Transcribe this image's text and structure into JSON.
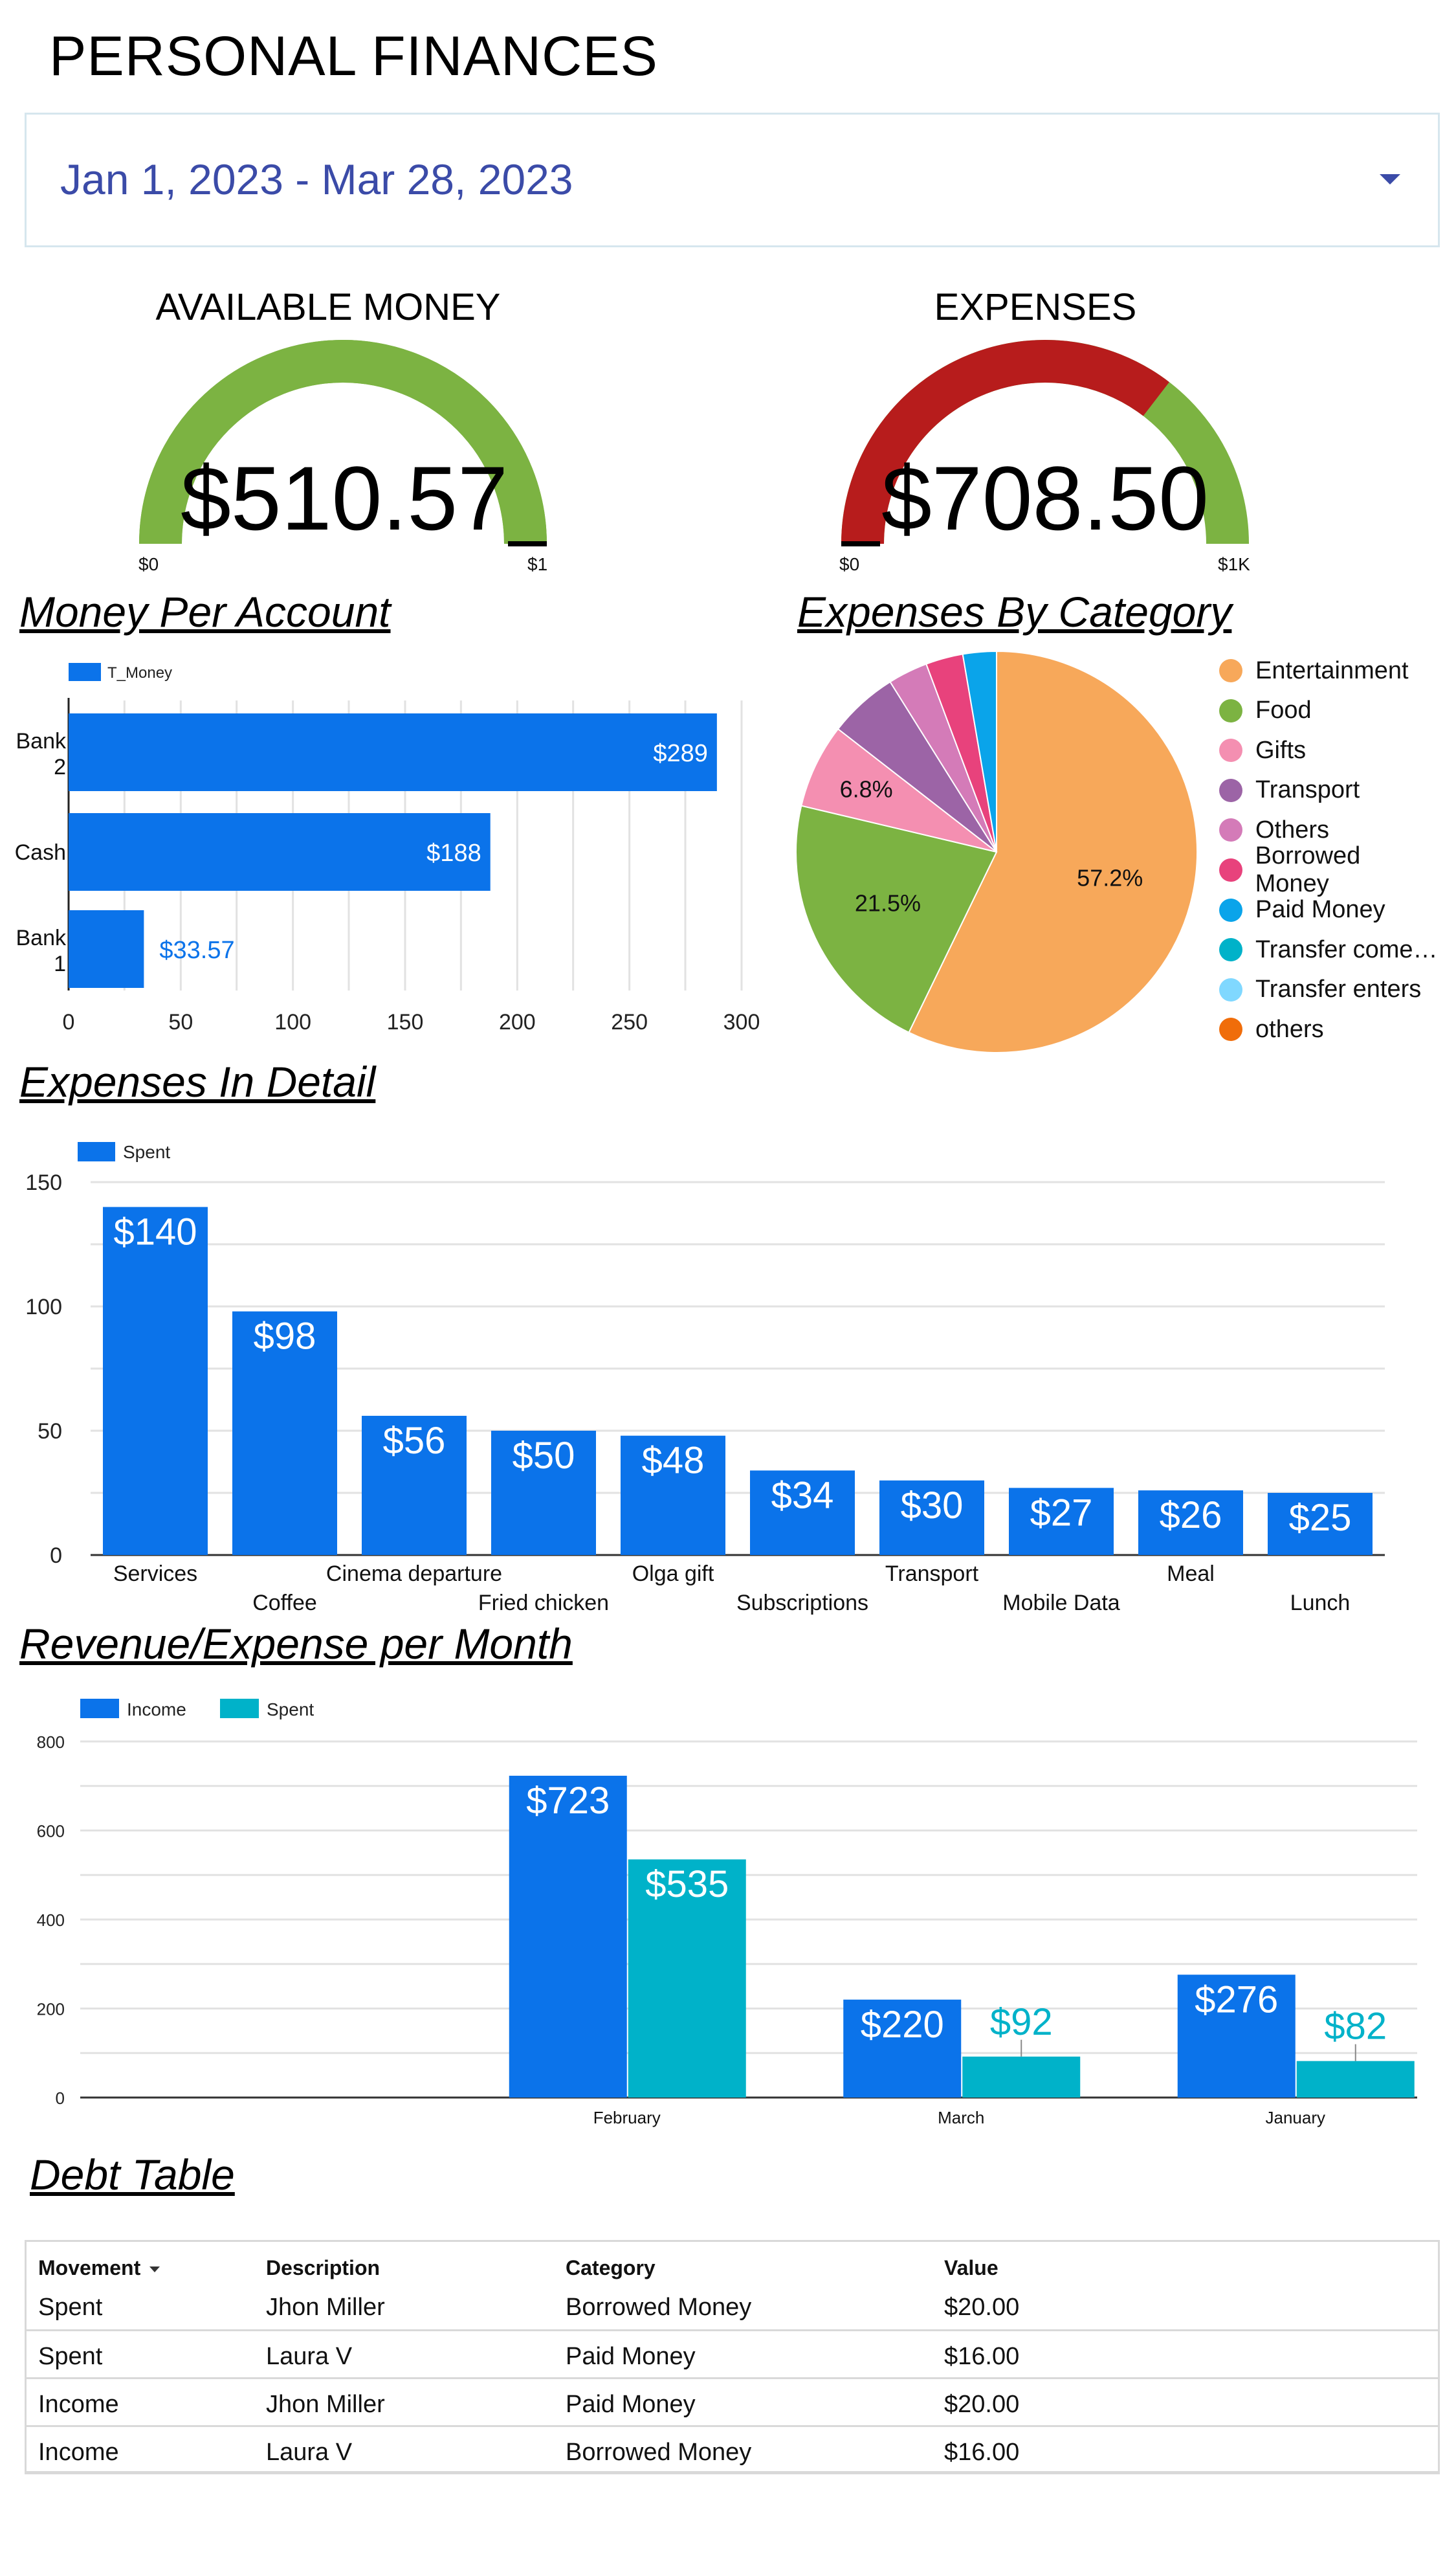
{
  "header": {
    "title": "PERSONAL FINANCES",
    "date_range": "Jan 1, 2023 - Mar 28, 2023"
  },
  "gauges": {
    "available": {
      "title": "AVAILABLE MONEY",
      "value_label": "$510.57",
      "min_label": "$0",
      "max_label": "$1"
    },
    "expenses": {
      "title": "EXPENSES",
      "value_label": "$708.50",
      "min_label": "$0",
      "max_label": "$1K",
      "fill_fraction": 0.7085
    }
  },
  "sections": {
    "money_per_account": "Money Per Account",
    "expenses_by_category": "Expenses By Category",
    "expenses_in_detail": "Expenses In Detail",
    "revenue_expense": "Revenue/Expense per Month",
    "debt_table": "Debt Table"
  },
  "colors": {
    "primary_bar": "#0b73ea",
    "secondary_bar": "#00b2c9",
    "gauge_green": "#7cb342",
    "gauge_red": "#b71c1c",
    "title_blue": "#3b4ba8"
  },
  "chart_data": [
    {
      "type": "bar",
      "orientation": "horizontal",
      "categories": [
        "Bank\n2",
        "Cash",
        "Bank\n1"
      ],
      "series": [
        {
          "name": "T_Money",
          "values": [
            289,
            188,
            33.57
          ]
        }
      ],
      "data_labels": [
        "$289",
        "$188",
        "$33.57"
      ],
      "xlim": [
        0,
        300
      ],
      "xticks": [
        "0",
        "50",
        "100",
        "150",
        "200",
        "250",
        "300"
      ],
      "grid": true,
      "legend": "top-left"
    },
    {
      "type": "pie",
      "labels": [
        "Entertainment",
        "Food",
        "Gifts",
        "Transport",
        "Others",
        "Borrowed Money",
        "Paid Money",
        "Transfer come…",
        "Transfer enters",
        "others"
      ],
      "values": [
        57.2,
        21.5,
        6.8,
        5.6,
        3.2,
        3.0,
        2.7,
        0,
        0,
        0
      ],
      "colors": [
        "#f7a85a",
        "#7cb342",
        "#f48fb1",
        "#9c64a6",
        "#d47bb8",
        "#e8427c",
        "#0aa4ea",
        "#00b2c9",
        "#80d8ff",
        "#f06d0a"
      ],
      "slice_labels": [
        "57.2%",
        "21.5%",
        "6.8%"
      ],
      "legend": "right"
    },
    {
      "type": "bar",
      "categories": [
        "Services",
        "Coffee",
        "Cinema departure",
        "Fried chicken",
        "Olga gift",
        "Subscriptions",
        "Transport",
        "Mobile Data",
        "Meal",
        "Lunch"
      ],
      "series": [
        {
          "name": "Spent",
          "values": [
            140,
            98,
            56,
            50,
            48,
            34,
            30,
            27,
            26,
            25
          ]
        }
      ],
      "data_labels": [
        "$140",
        "$98",
        "$56",
        "$50",
        "$48",
        "$34",
        "$30",
        "$27",
        "$26",
        "$25"
      ],
      "ylim": [
        0,
        150
      ],
      "yticks": [
        "0",
        "50",
        "100",
        "150"
      ],
      "grid": true,
      "legend": "top-left"
    },
    {
      "type": "bar",
      "categories": [
        "",
        "February",
        "March",
        "January"
      ],
      "series": [
        {
          "name": "Income",
          "values": [
            0,
            723,
            220,
            276
          ],
          "data_labels": [
            "",
            "$723",
            "$220",
            "$276"
          ]
        },
        {
          "name": "Spent",
          "values": [
            0,
            535,
            92,
            82
          ],
          "data_labels": [
            "",
            "$535",
            "$92",
            "$82"
          ]
        }
      ],
      "ylim": [
        0,
        800
      ],
      "yticks": [
        "0",
        "200",
        "400",
        "600",
        "800"
      ],
      "grid": true,
      "legend": "top-left"
    }
  ],
  "debt_table": {
    "headers": [
      "Movement",
      "Description",
      "Category",
      "Value"
    ],
    "rows": [
      [
        "Spent",
        "Jhon Miller",
        "Borrowed Money",
        "$20.00"
      ],
      [
        "Spent",
        "Laura V",
        "Paid Money",
        "$16.00"
      ],
      [
        "Income",
        "Jhon Miller",
        "Paid Money",
        "$20.00"
      ],
      [
        "Income",
        "Laura V",
        "Borrowed Money",
        "$16.00"
      ]
    ]
  }
}
